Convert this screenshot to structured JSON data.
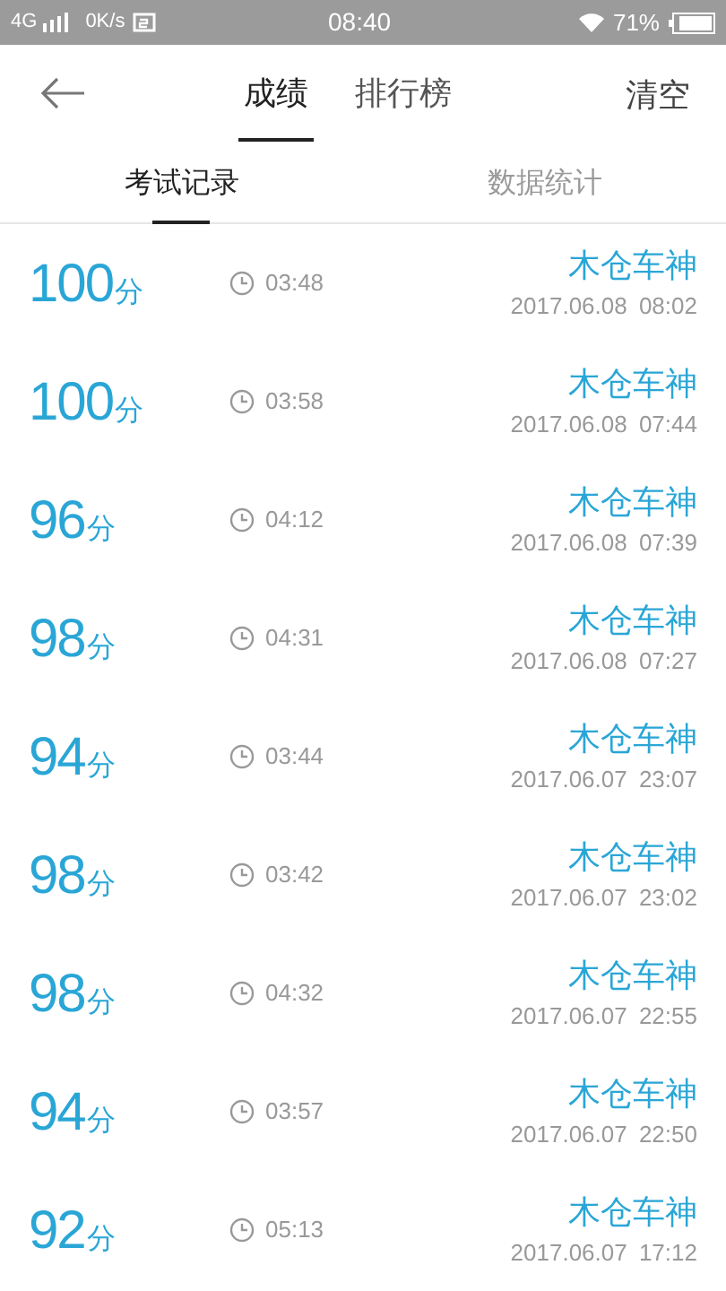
{
  "status_bar": {
    "network": "4G",
    "speed": "0K/s",
    "time": "08:40",
    "battery": "71%"
  },
  "header": {
    "tabs": [
      {
        "label": "成绩",
        "selected": true
      },
      {
        "label": "排行榜",
        "selected": false
      }
    ],
    "action": "清空"
  },
  "sub_tabs": [
    {
      "label": "考试记录",
      "selected": true
    },
    {
      "label": "数据统计",
      "selected": false
    }
  ],
  "records": [
    {
      "score": "100",
      "unit": "分",
      "duration": "03:48",
      "name": "木仓车神",
      "datetime": "2017.06.08 08:02"
    },
    {
      "score": "100",
      "unit": "分",
      "duration": "03:58",
      "name": "木仓车神",
      "datetime": "2017.06.08 07:44"
    },
    {
      "score": "96",
      "unit": "分",
      "duration": "04:12",
      "name": "木仓车神",
      "datetime": "2017.06.08 07:39"
    },
    {
      "score": "98",
      "unit": "分",
      "duration": "04:31",
      "name": "木仓车神",
      "datetime": "2017.06.08 07:27"
    },
    {
      "score": "94",
      "unit": "分",
      "duration": "03:44",
      "name": "木仓车神",
      "datetime": "2017.06.07 23:07"
    },
    {
      "score": "98",
      "unit": "分",
      "duration": "03:42",
      "name": "木仓车神",
      "datetime": "2017.06.07 23:02"
    },
    {
      "score": "98",
      "unit": "分",
      "duration": "04:32",
      "name": "木仓车神",
      "datetime": "2017.06.07 22:55"
    },
    {
      "score": "94",
      "unit": "分",
      "duration": "03:57",
      "name": "木仓车神",
      "datetime": "2017.06.07 22:50"
    },
    {
      "score": "92",
      "unit": "分",
      "duration": "05:13",
      "name": "木仓车神",
      "datetime": "2017.06.07 17:12"
    }
  ]
}
